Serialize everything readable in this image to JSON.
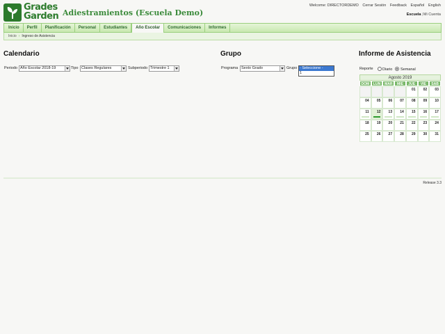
{
  "header": {
    "logo_line1": "Grades",
    "logo_line2": "Garden",
    "school_title": "Adiestramientos (Escuela Demo)",
    "welcome": "Welcome: DIRECTORDEMO",
    "logout": "Cerrar Sesión",
    "feedback": "Feedback",
    "lang_es": "Español",
    "lang_en": "English",
    "scope_school": "Escuela",
    "scope_mine": "Mi Cuenta"
  },
  "nav": {
    "items": [
      "Inicio",
      "Perfil",
      "Planificación",
      "Personal",
      "Estudiantes",
      "Año Escolar",
      "Comunicaciones",
      "Informes"
    ],
    "active_index": 5
  },
  "breadcrumb": {
    "home": "Inicio",
    "current": "Ingreso de Asistencia"
  },
  "calendario": {
    "title": "Calendario",
    "periodo_label": "Periodo",
    "periodo_value": "Año Escolar 2018-19",
    "tipo_label": "Tipo",
    "tipo_value": "Clases Regulares",
    "subperiodo_label": "Subperiodo",
    "subperiodo_value": "Trimestre 1"
  },
  "grupo": {
    "title": "Grupo",
    "programa_label": "Programa",
    "programa_value": "Sexto Grado",
    "grupo_label": "Grupo",
    "options": [
      "- Seleccione -",
      "1"
    ],
    "selected_option": "- Seleccione -"
  },
  "informe": {
    "title": "Informe de Asistencia",
    "reporte_label": "Reporte",
    "diario_label": "Diario",
    "semanal_label": "Semanal",
    "selected": "Semanal",
    "month_title": "Agosto 2019",
    "weekdays": [
      "DOM",
      "LUN",
      "MAR",
      "MIE",
      "JUE",
      "VIE",
      "SAB"
    ],
    "weeks": [
      [
        "",
        "",
        "",
        "",
        "01",
        "02",
        "03"
      ],
      [
        "04",
        "05",
        "06",
        "07",
        "08",
        "09",
        "10"
      ],
      [
        "11",
        "12",
        "13",
        "14",
        "15",
        "16",
        "17"
      ],
      [
        "18",
        "19",
        "20",
        "21",
        "22",
        "23",
        "24"
      ],
      [
        "25",
        "26",
        "27",
        "28",
        "29",
        "30",
        "31"
      ]
    ],
    "today": "12"
  },
  "footer": {
    "release": "Release 3.3"
  },
  "colors": {
    "brand_green": "#2d7c2d",
    "nav_border": "#9acf7e",
    "calendar_header": "#7ab86a",
    "selection_blue": "#3b78d0"
  }
}
